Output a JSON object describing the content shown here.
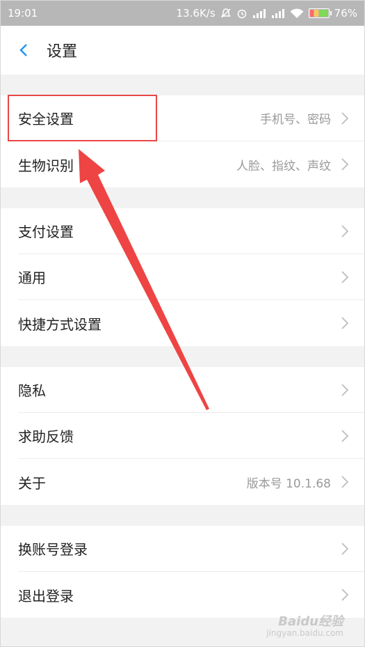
{
  "status_bar": {
    "time": "19:01",
    "speed": "13.6K/s",
    "battery": "76%"
  },
  "header": {
    "title": "设置"
  },
  "groups": [
    [
      {
        "label": "安全设置",
        "value": "手机号、密码"
      },
      {
        "label": "生物识别",
        "value": "人脸、指纹、声纹"
      }
    ],
    [
      {
        "label": "支付设置",
        "value": ""
      },
      {
        "label": "通用",
        "value": ""
      },
      {
        "label": "快捷方式设置",
        "value": ""
      }
    ],
    [
      {
        "label": "隐私",
        "value": ""
      },
      {
        "label": "求助反馈",
        "value": ""
      },
      {
        "label": "关于",
        "value": "版本号 10.1.68"
      }
    ],
    [
      {
        "label": "换账号登录",
        "value": ""
      },
      {
        "label": "退出登录",
        "value": ""
      }
    ]
  ],
  "watermark": {
    "brand": "Baidu经验",
    "url": "jingyan.baidu.com"
  },
  "colors": {
    "accent": "#2196f3",
    "annotation": "#e84545"
  }
}
